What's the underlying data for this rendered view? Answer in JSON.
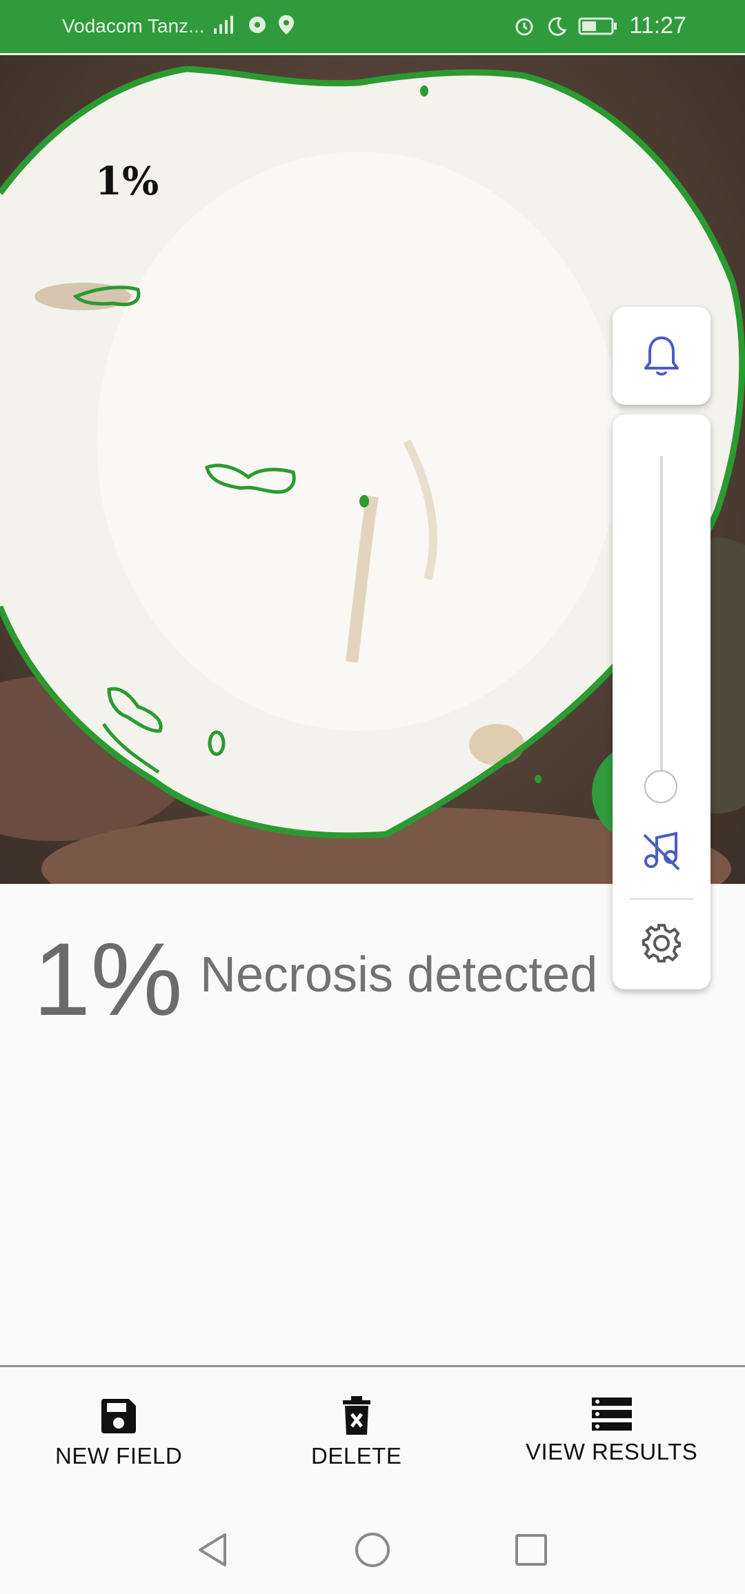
{
  "status_bar": {
    "carrier": "Vodacom Tanz...",
    "time": "11:27",
    "icons": [
      "signal-icon",
      "data-icon",
      "location-icon",
      "alarm-icon",
      "moon-icon",
      "battery-icon"
    ],
    "background": "#2f9b3d"
  },
  "image": {
    "overlay_percentage": "1%",
    "contour_color": "#2b9a31"
  },
  "volume_panel": {
    "level_fraction": 0.0,
    "icons": [
      "bell-icon",
      "music-off-icon",
      "gear-icon"
    ],
    "accent": "#4a5cc4"
  },
  "result": {
    "percentage": "1%",
    "label": "Necrosis detected"
  },
  "actions": [
    {
      "label": "NEW FIELD",
      "icon": "save-icon"
    },
    {
      "label": "DELETE",
      "icon": "delete-icon"
    },
    {
      "label": "VIEW RESULTS",
      "icon": "list-icon"
    }
  ],
  "nav": [
    "back-icon",
    "home-icon",
    "recents-icon"
  ]
}
